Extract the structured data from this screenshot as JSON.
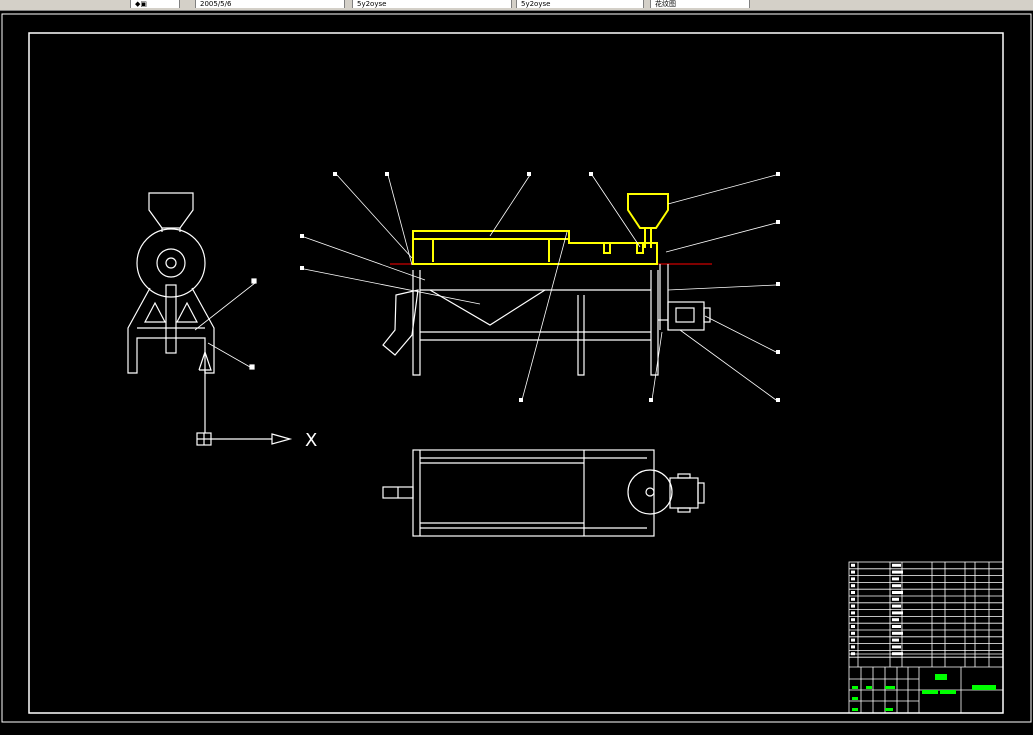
{
  "app": {
    "tabs": [
      {
        "label": "2005/5/6"
      },
      {
        "label": "5y2oyse"
      },
      {
        "label": "5y2oyse"
      },
      {
        "label": "花纹图"
      }
    ]
  },
  "drawing": {
    "axis_label": "X",
    "colors": {
      "background": "#000000",
      "lines": "#ffffff",
      "highlight": "#ffff00",
      "centerline": "#ff0000",
      "title_text": "#00ff00"
    }
  }
}
